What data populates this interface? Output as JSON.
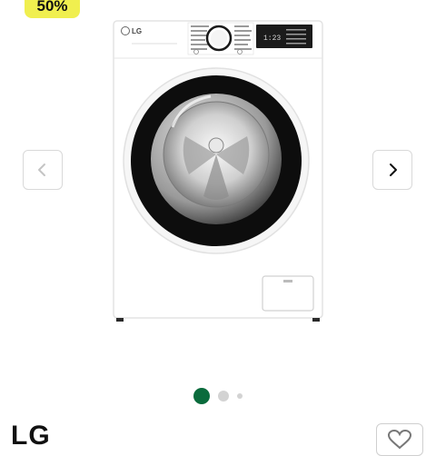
{
  "badge": {
    "discount": "50%"
  },
  "carousel": {
    "prev_icon": "chevron-left-icon",
    "next_icon": "chevron-right-icon",
    "image_count": 3,
    "active_index": 0
  },
  "product_image": {
    "brand_logo": "LG",
    "display_digits": "1:23",
    "door_color": "#111111",
    "body_color": "#ffffff"
  },
  "product": {
    "brand": "LG",
    "wishlist_icon": "heart-icon"
  },
  "colors": {
    "badge": "#f0ef4f",
    "active_dot": "#0a6b3c",
    "inactive_dot": "#d3d3d3"
  }
}
